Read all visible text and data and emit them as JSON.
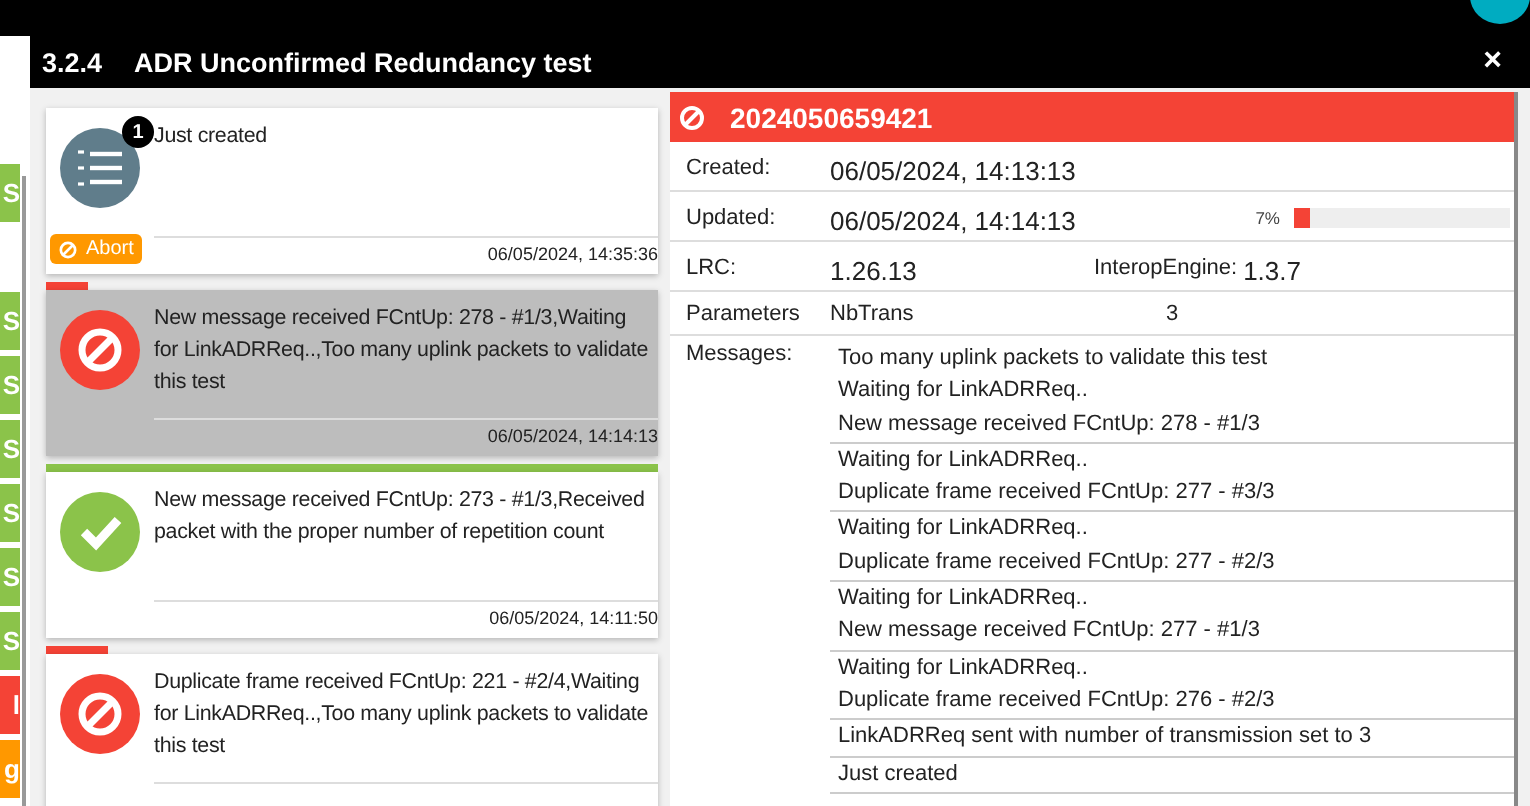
{
  "page_strip": {
    "badges": [
      {
        "label": "S",
        "color": "#8bc34a"
      },
      {
        "label": "S",
        "color": "#8bc34a"
      },
      {
        "label": "S",
        "color": "#8bc34a"
      },
      {
        "label": "S",
        "color": "#8bc34a"
      },
      {
        "label": "S",
        "color": "#8bc34a"
      },
      {
        "label": "S",
        "color": "#8bc34a"
      },
      {
        "label": "S",
        "color": "#8bc34a"
      },
      {
        "label": "l",
        "color": "#f44336"
      },
      {
        "label": "g",
        "color": "#ff9800"
      }
    ]
  },
  "dialog": {
    "number": "3.2.4",
    "title": "ADR Unconfirmed Redundancy test",
    "close": "×",
    "cards": [
      {
        "kind": "pending",
        "count": "1",
        "text": "Just created",
        "action": "Abort",
        "time": "06/05/2024, 14:35:36",
        "selected": false
      },
      {
        "kind": "error",
        "text": "New message received FCntUp: 278 - #1/3,Waiting for LinkADRReq..,Too many uplink packets to validate this test",
        "time": "06/05/2024, 14:14:13",
        "level": 0.07,
        "selected": true
      },
      {
        "kind": "success",
        "text": "New message received FCntUp: 273 - #1/3,Received packet with the proper number of repetition count",
        "time": "06/05/2024, 14:11:50",
        "level": 1,
        "selected": false
      },
      {
        "kind": "error",
        "text": "Duplicate frame received FCntUp: 221 - #2/4,Waiting for LinkADRReq..,Too many uplink packets to validate this test",
        "level": 0.1,
        "selected": false
      }
    ],
    "detail": {
      "kind": "error",
      "id": "2024050659421",
      "created_label": "Created:",
      "created": "06/05/2024, 14:13:13",
      "updated_label": "Updated:",
      "updated": "06/05/2024, 14:14:13",
      "progress": {
        "reading": "7%",
        "level": 0.07
      },
      "lrc_label": "LRC:",
      "lrc": "1.26.13",
      "engine_label": "InteropEngine:",
      "engine": "1.3.7",
      "params_label": "Parameters",
      "params": [
        {
          "name": "NbTrans",
          "value": "3"
        }
      ],
      "messages_label": "Messages:",
      "message_groups": [
        [
          "Too many uplink packets to validate this test",
          "Waiting for LinkADRReq..",
          "New message received FCntUp: 278 - #1/3"
        ],
        [
          "Waiting for LinkADRReq..",
          "Duplicate frame received FCntUp: 277 - #3/3"
        ],
        [
          "Waiting for LinkADRReq..",
          "Duplicate frame received FCntUp: 277 - #2/3"
        ],
        [
          "Waiting for LinkADRReq..",
          "New message received FCntUp: 277 - #1/3"
        ],
        [
          "Waiting for LinkADRReq..",
          "Duplicate frame received FCntUp: 276 - #2/3"
        ],
        [
          "LinkADRReq sent with number of transmission set to 3"
        ],
        [
          "Just created"
        ]
      ]
    }
  }
}
